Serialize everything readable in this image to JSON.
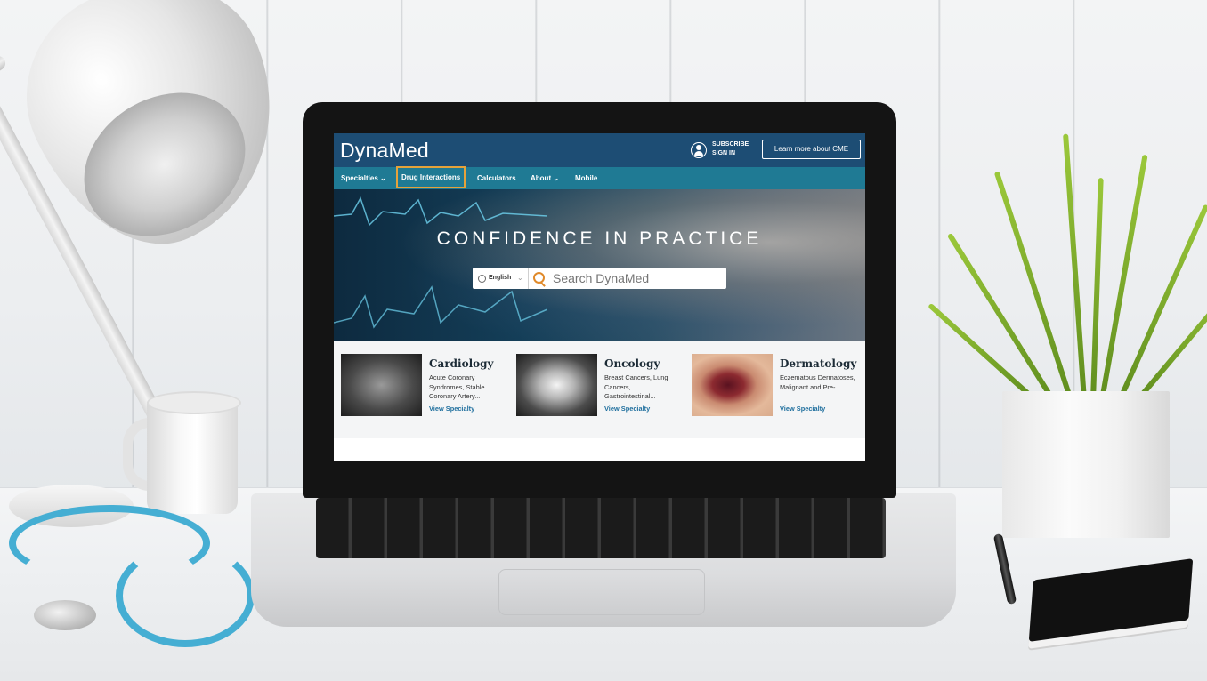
{
  "app": {
    "logo": "DynaMed"
  },
  "header": {
    "subscribe": "SUBSCRIBE",
    "sign_in": "SIGN IN",
    "cme_button": "Learn more about CME"
  },
  "nav": {
    "items": [
      {
        "label": "Specialties ⌄"
      },
      {
        "label": "Drug Interactions"
      },
      {
        "label": "Calculators"
      },
      {
        "label": "About ⌄"
      },
      {
        "label": "Mobile"
      }
    ]
  },
  "hero": {
    "title": "CONFIDENCE IN PRACTICE",
    "language": "English",
    "search_placeholder": "Search DynaMed"
  },
  "specialties": [
    {
      "title": "Cardiology",
      "description": "Acute Coronary Syndromes, Stable Coronary Artery...",
      "link": "View Specialty",
      "icon": "cardiology-xray-image"
    },
    {
      "title": "Oncology",
      "description": "Breast Cancers, Lung Cancers, Gastrointestinal...",
      "link": "View Specialty",
      "icon": "oncology-scan-image"
    },
    {
      "title": "Dermatology",
      "description": "Eczematous Dermatoses, Malignant and Pre-...",
      "link": "View Specialty",
      "icon": "dermatology-skin-image"
    }
  ],
  "colors": {
    "header_bg": "#1d4d74",
    "nav_bg": "#1f7a94",
    "highlight_border": "#e5a23a",
    "search_icon": "#e08a2b",
    "link": "#1f6f9e"
  }
}
